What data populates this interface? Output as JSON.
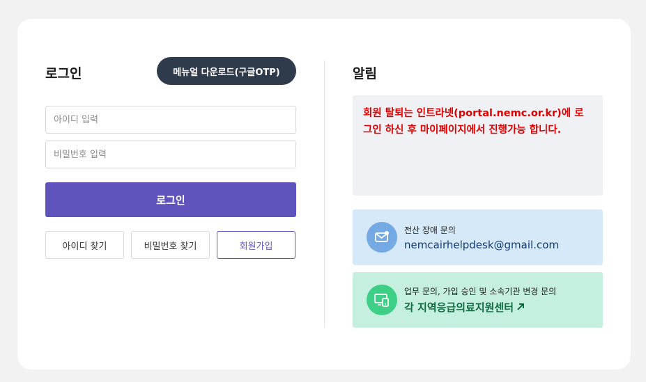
{
  "login": {
    "title": "로그인",
    "manual_button": "메뉴얼 다운로드(구글OTP)",
    "id_placeholder": "아이디 입력",
    "password_placeholder": "비밀번호 입력",
    "login_button": "로그인",
    "find_id": "아이디 찾기",
    "find_password": "비밀번호 찾기",
    "signup": "회원가입"
  },
  "notice": {
    "title": "알림",
    "message": "회원 탈퇴는 인트라넷(portal.nemc.or.kr)에 로그인 하신 후 마이페이지에서 진행가능 합니다."
  },
  "contacts": {
    "it_label": "전산 장애 문의",
    "it_email": "nemcairhelpdesk@gmail.com",
    "biz_label": "업무 문의, 가입 승인 및 소속기관 변경 문의",
    "biz_link": "각 지역응급의료지원센터"
  },
  "icons": {
    "mail": "mail-icon",
    "device": "device-icon",
    "external": "external-arrow-icon"
  },
  "colors": {
    "primary": "#5f53bc",
    "dark": "#2f3a4b",
    "notice_text": "#e10000",
    "mail_bg": "#d5e9f9",
    "center_bg": "#c5efdf"
  }
}
